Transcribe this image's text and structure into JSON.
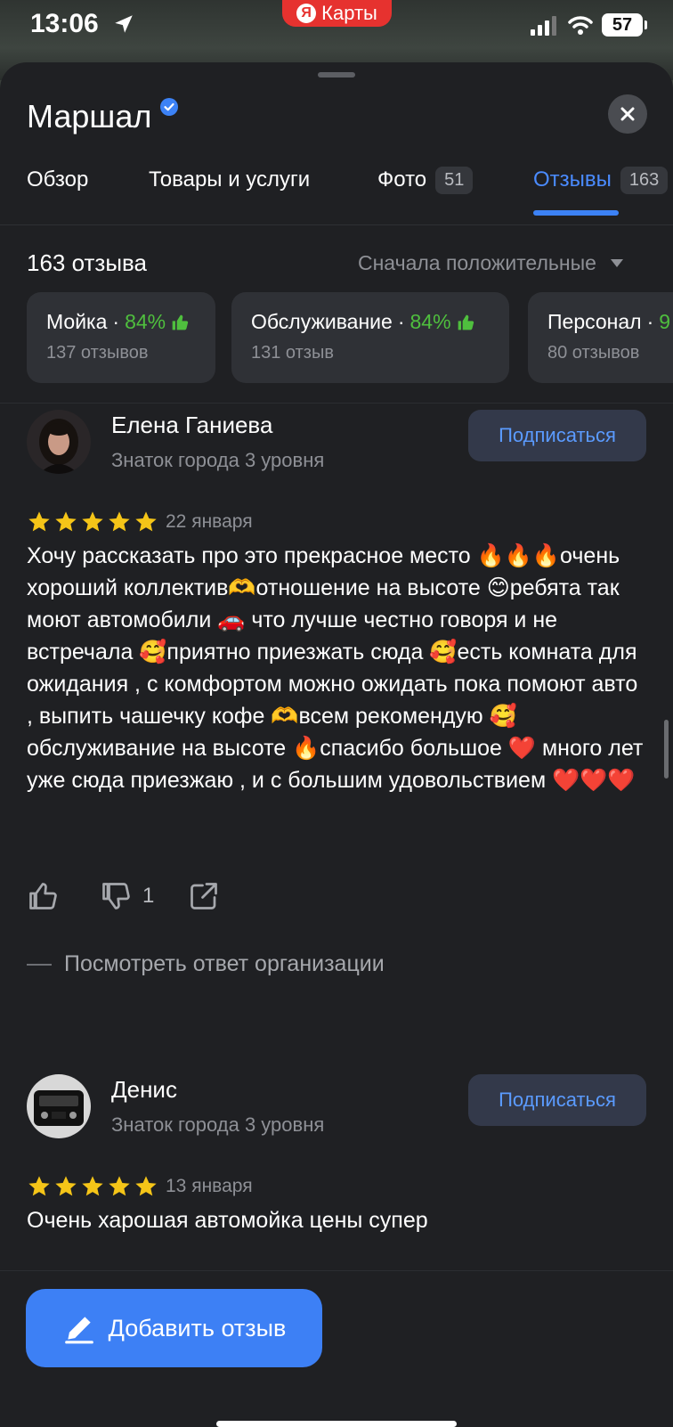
{
  "status_bar": {
    "time": "13:06",
    "app_name": "Карты",
    "app_logo_letter": "Я",
    "battery": "57"
  },
  "place": {
    "title": "Маршал"
  },
  "tabs": [
    {
      "label": "Обзор"
    },
    {
      "label": "Товары и услуги"
    },
    {
      "label": "Фото",
      "count": "51"
    },
    {
      "label": "Отзывы",
      "count": "163",
      "active": true
    }
  ],
  "reviews_header": {
    "count_label": "163 отзыва",
    "sort_label": "Сначала положительные"
  },
  "categories": [
    {
      "name": "Мойка",
      "percent": "84%",
      "sub": "137 отзывов"
    },
    {
      "name": "Обслуживание",
      "percent": "84%",
      "sub": "131 отзыв"
    },
    {
      "name": "Персонал",
      "percent": "9",
      "sub": "80 отзывов"
    }
  ],
  "reviews": [
    {
      "author": "Елена Ганиева",
      "level": "Знаток города 3 уровня",
      "subscribe_label": "Подписаться",
      "rating": 5,
      "date": "22 января",
      "text": "Хочу рассказать про это прекрасное место 🔥🔥🔥очень хороший коллектив🫶отношение на высоте 😊ребята так моют автомобили 🚗 что лучше честно говоря и не встречала 🥰приятно приезжать сюда 🥰есть комната для ожидания , с комфортом можно ожидать пока помоют авто , выпить чашечку кофе 🫶всем рекомендую 🥰 обслуживание на высоте 🔥спасибо большое ❤️ много лет уже сюда приезжаю , и с большим удовольствием ❤️❤️❤️",
      "dislikes": "1",
      "org_reply_label": "Посмотреть ответ организации"
    },
    {
      "author": "Денис",
      "level": "Знаток города 3 уровня",
      "subscribe_label": "Подписаться",
      "rating": 5,
      "date": "13 января",
      "text": "Очень харошая автомойка цены супер"
    }
  ],
  "add_review_label": "Добавить отзыв",
  "colors": {
    "accent": "#3d80f5",
    "positive": "#4fbf3e",
    "star": "#f5c518",
    "background": "#1f2023"
  }
}
